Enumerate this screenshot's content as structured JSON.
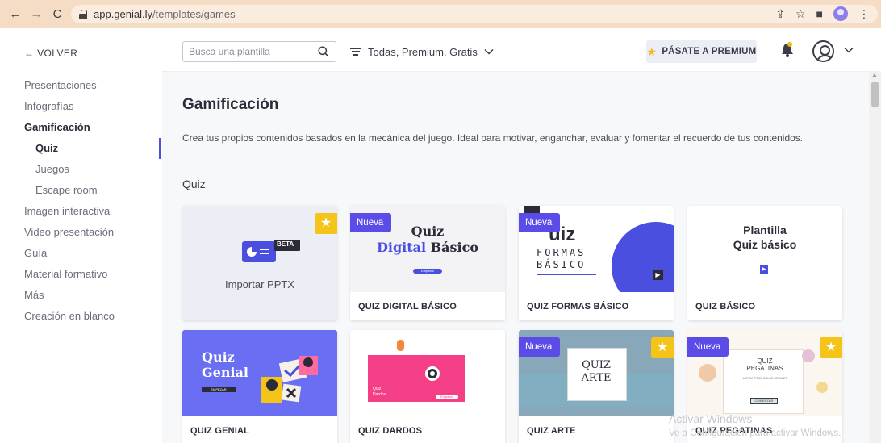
{
  "browser": {
    "url_host": "app.genial.ly",
    "url_path": "/templates/games"
  },
  "sidebar": {
    "back_label": "← VOLVER",
    "items": [
      {
        "label": "Presentaciones"
      },
      {
        "label": "Infografías"
      },
      {
        "label": "Gamificación"
      },
      {
        "label": "Quiz"
      },
      {
        "label": "Juegos"
      },
      {
        "label": "Escape room"
      },
      {
        "label": "Imagen interactiva"
      },
      {
        "label": "Video presentación"
      },
      {
        "label": "Guía"
      },
      {
        "label": "Material formativo"
      },
      {
        "label": "Más"
      },
      {
        "label": "Creación en blanco"
      }
    ]
  },
  "header": {
    "search_placeholder": "Busca una plantilla",
    "filter_label": "Todas, Premium, Gratis",
    "premium_label": "PÁSATE A PREMIUM"
  },
  "main": {
    "title": "Gamificación",
    "description": "Crea tus propios contenidos basados en la mecánica del juego. Ideal para motivar, enganchar, evaluar y fomentar el recuerdo de tus contenidos.",
    "section": "Quiz",
    "new_badge": "Nueva",
    "beta": "BETA",
    "cards": [
      {
        "label": "Importar PPTX"
      },
      {
        "label": "QUIZ DIGITAL BÁSICO",
        "thumb_line1": "Quiz",
        "thumb_line2a": "Digital",
        "thumb_line2b": "Básico",
        "thumb_btn": "Empezar"
      },
      {
        "label": "QUIZ FORMAS BÁSICO",
        "thumb_line1": "uiz",
        "thumb_line2": "FORMAS",
        "thumb_line3": "BÁSICO"
      },
      {
        "label": "QUIZ BÁSICO",
        "thumb_line1": "Plantilla",
        "thumb_line2": "Quiz básico"
      },
      {
        "label": "QUIZ GENIAL",
        "thumb_line1": "Quiz",
        "thumb_line2": "Genial",
        "thumb_btn": "EMPEZAR"
      },
      {
        "label": "QUIZ DARDOS",
        "thumb_line1": "Quiz",
        "thumb_line2": "Dardos",
        "thumb_btn": "Empezar"
      },
      {
        "label": "QUIZ ARTE",
        "thumb_line1": "QUIZ",
        "thumb_line2": "ARTE"
      },
      {
        "label": "QUIZ PEGATINAS",
        "thumb_line1": "QUIZ",
        "thumb_line2": "PEGATINAS",
        "thumb_line3": "LOREM IPSUM DOLOR SIT AMET",
        "thumb_btn": "COMENZAR"
      }
    ]
  },
  "watermark": {
    "line1": "Activar Windows",
    "line2": "Ve a Configuración para activar Windows."
  },
  "colors": {
    "accent": "#4b4fe0",
    "badge": "#5b4ce8",
    "star": "#f4c418",
    "chrome": "#f4dcc5"
  }
}
